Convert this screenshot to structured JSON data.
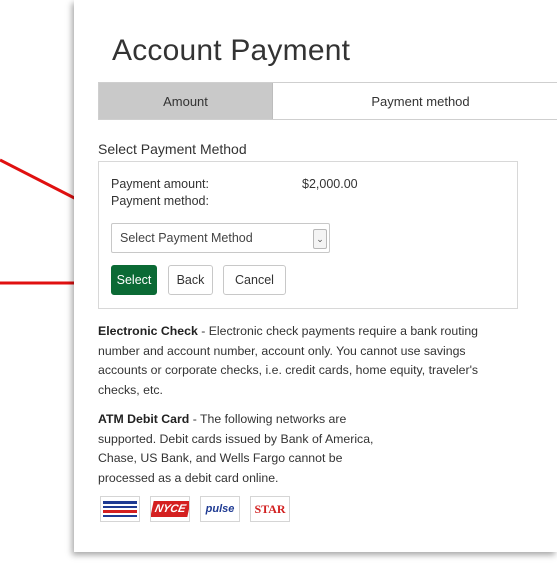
{
  "page": {
    "title": "Account Payment"
  },
  "tabs": [
    {
      "label": "Amount",
      "active": true
    },
    {
      "label": "Payment method",
      "active": false
    }
  ],
  "section": {
    "heading": "Select Payment Method"
  },
  "form": {
    "amount_label": "Payment amount:",
    "amount_value": "$2,000.00",
    "method_label": "Payment method:",
    "method_select": {
      "selected": "Select Payment Method"
    }
  },
  "buttons": {
    "select": "Select",
    "back": "Back",
    "cancel": "Cancel"
  },
  "info": {
    "echeck_title": "Electronic Check",
    "echeck_text": " - Electronic check payments require a bank routing number and account number, account only. You cannot use savings accounts or corporate checks, i.e. credit cards, home equity, traveler's checks, etc.",
    "atm_title": "ATM Debit Card",
    "atm_text": " - The following networks are supported. Debit cards issued by Bank of America, Chase, US Bank, and Wells Fargo cannot be processed as a debit card online."
  },
  "networks": [
    {
      "name": "accel-logo",
      "label": "ACCEL"
    },
    {
      "name": "nyce-logo",
      "label": "NYCE"
    },
    {
      "name": "pulse-logo",
      "label": "pulse"
    },
    {
      "name": "star-logo",
      "label": "STAR"
    }
  ],
  "colors": {
    "primary_button": "#0b6a35",
    "active_tab": "#c9c9c9",
    "annotation_arrow": "#e01010"
  }
}
